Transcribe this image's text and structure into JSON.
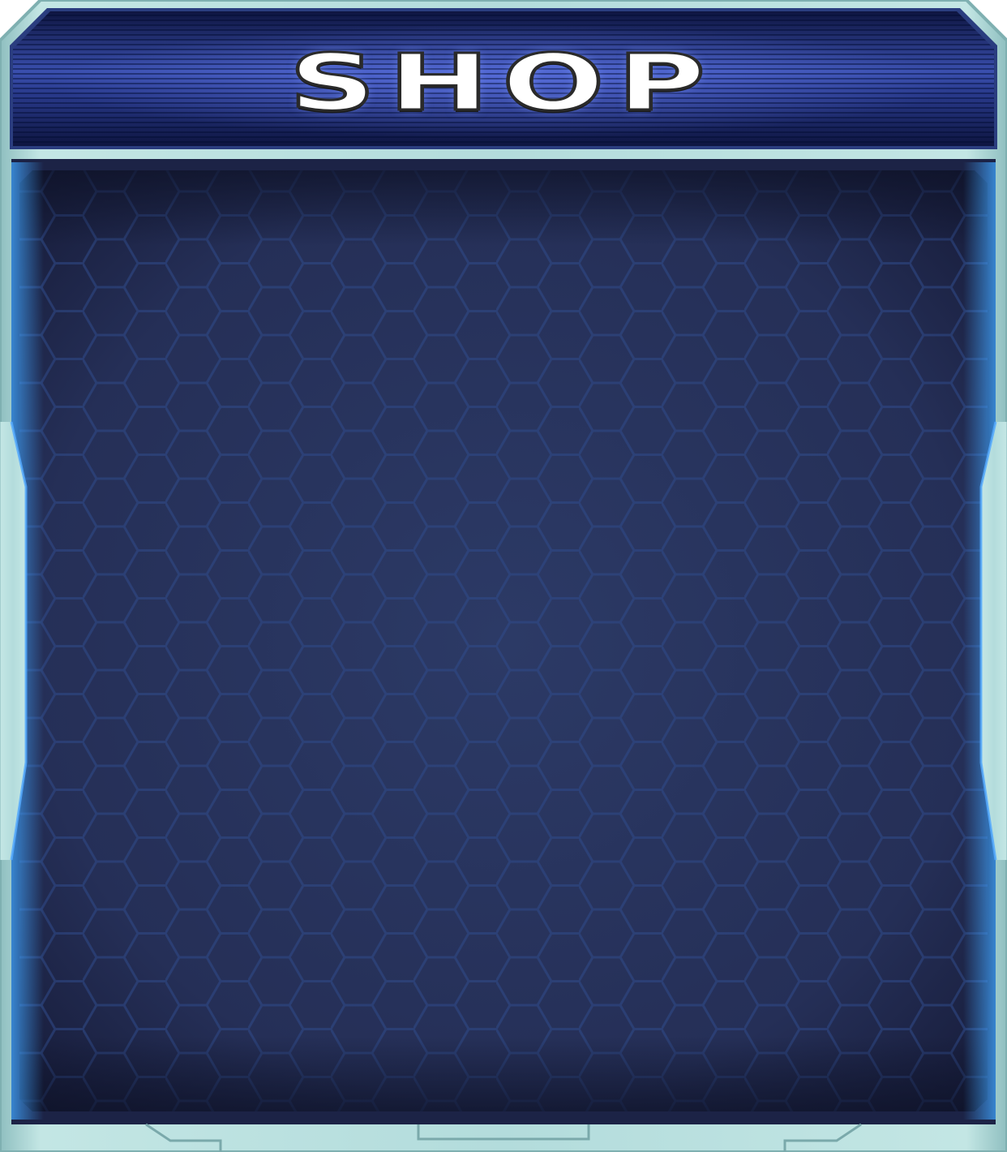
{
  "header": {
    "title": "SHOP"
  },
  "theme": {
    "frame_color": "#a9d3d3",
    "header_color": "#1e2a6e",
    "panel_color": "#26305a",
    "glow_color": "#2f8cff"
  }
}
